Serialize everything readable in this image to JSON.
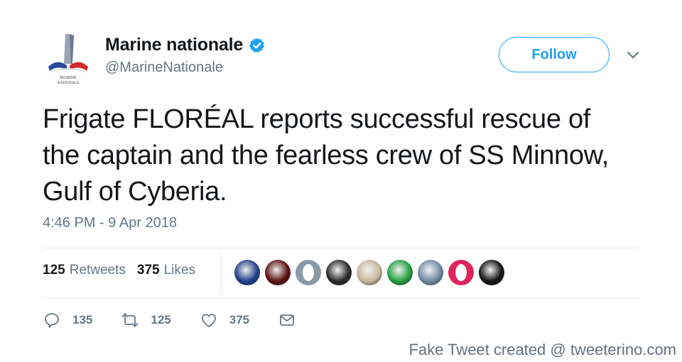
{
  "account": {
    "display_name": "Marine nationale",
    "handle": "@MarineNationale",
    "avatar_text_line1": "MARINE",
    "avatar_text_line2": "NATIONALE",
    "verified": true
  },
  "follow_label": "Follow",
  "tweet": {
    "text": "Frigate FLORÉAL reports successful rescue of the captain and the fearless crew of SS Minnow, Gulf of Cyberia.",
    "timestamp": "4:46 PM - 9 Apr 2018"
  },
  "stats": {
    "retweets_count": "125",
    "retweets_label": "Retweets",
    "likes_count": "375",
    "likes_label": "Likes"
  },
  "liker_avatars": [
    {
      "name": "avatar-trump-seal",
      "color": "#1f3f8a"
    },
    {
      "name": "avatar-flag-crowd",
      "color": "#5a1010"
    },
    {
      "name": "avatar-grey-ring",
      "color": "#8a99a6"
    },
    {
      "name": "avatar-bw-portrait",
      "color": "#2a2a2a"
    },
    {
      "name": "avatar-cartoon",
      "color": "#c7b59a"
    },
    {
      "name": "avatar-iran-flag",
      "color": "#239f40"
    },
    {
      "name": "avatar-photo-person",
      "color": "#6f8aa3"
    },
    {
      "name": "avatar-red-ring",
      "color": "#e0245e"
    },
    {
      "name": "avatar-dark-face",
      "color": "#111111"
    }
  ],
  "actions": {
    "replies": "135",
    "retweets": "125",
    "likes": "375"
  },
  "watermark": "Fake Tweet created @ tweeterino.com",
  "colors": {
    "accent": "#1da1f2",
    "secondary_text": "#657786",
    "divider": "#e6ecf0"
  }
}
